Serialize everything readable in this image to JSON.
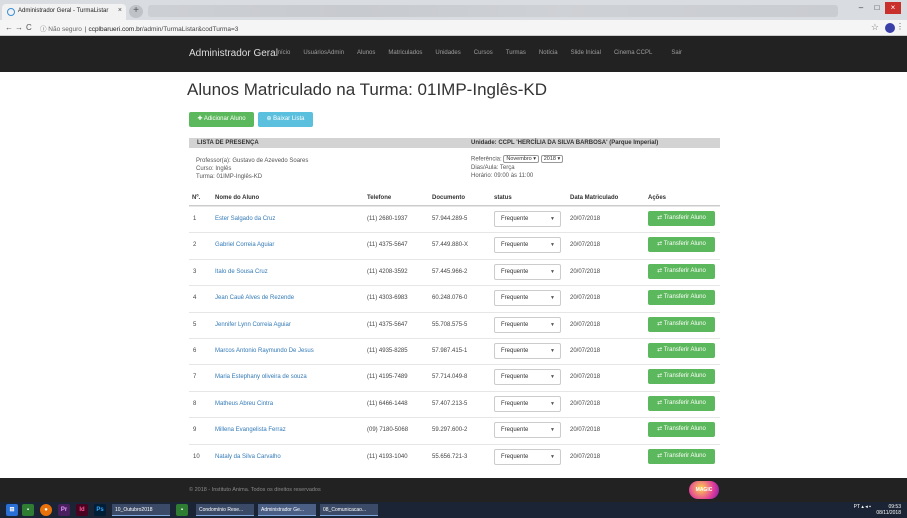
{
  "browser": {
    "tab_title": "Administrador Geral - TurmaListar",
    "tab_close": "×",
    "new_tab": "+",
    "url_security": "ⓘ Não seguro",
    "url_host": "ccplbarueri.com.br",
    "url_path": "/admin/TurmaListar&codTurma=3",
    "back": "←",
    "forward": "→",
    "reload": "C",
    "star": "☆",
    "menu": "⋮",
    "win_min": "–",
    "win_max": "□",
    "win_close": "×"
  },
  "nav": {
    "brand": "Administrador Geral",
    "links": [
      "Início",
      "UsuáriosAdmin",
      "Alunos",
      "Matriculados",
      "Unidades",
      "Cursos",
      "Turmas",
      "Notícia",
      "Slide Inicial",
      "Cinema CCPL",
      "Sair"
    ]
  },
  "page": {
    "title": "Alunos Matriculado na Turma: 01IMP-Inglês-KD",
    "add_button": "✚ Adicionar Aluno",
    "download_button": "⊕ Baixar Lista"
  },
  "presenca": {
    "left_label": "LISTA DE PRESENÇA",
    "right_label": "Unidade: CCPL 'HERCÍLIA DA SILVA BARBOSA' (Parque Imperial)",
    "professor": "Professor(a): Gustavo de Azevedo Soares",
    "curso": "Curso: Inglês",
    "turma": "Turma: 01IMP-Inglês-KD",
    "referencia_label": "Referência:",
    "mes": "Novembro ▾",
    "ano": "2018 ▾",
    "dias": "Dias/Aula: Terça",
    "horario": "Horário: 09:00 às 11:00"
  },
  "table": {
    "headers": {
      "n": "Nº.",
      "nome": "Nome do Aluno",
      "telefone": "Telefone",
      "documento": "Documento",
      "status": "status",
      "data": "Data Matriculado",
      "acoes": "Ações"
    },
    "rows": [
      {
        "n": "1",
        "nome": "Ester Salgado da Cruz",
        "telefone": "(11) 2680-1937",
        "documento": "57.944.289-5",
        "status": "Frequente",
        "data": "20/07/2018"
      },
      {
        "n": "2",
        "nome": "Gabriel Correia Aguiar",
        "telefone": "(11) 4375-5647",
        "documento": "57.449.880-X",
        "status": "Frequente",
        "data": "20/07/2018"
      },
      {
        "n": "3",
        "nome": "Italo de Sousa Cruz",
        "telefone": "(11) 4208-3592",
        "documento": "57.445.966-2",
        "status": "Frequente",
        "data": "20/07/2018"
      },
      {
        "n": "4",
        "nome": "Jean Cauê Alves de Rezende",
        "telefone": "(11) 4303-6983",
        "documento": "60.248.076-0",
        "status": "Frequente",
        "data": "20/07/2018"
      },
      {
        "n": "5",
        "nome": "Jennifer Lynn Correia Aguiar",
        "telefone": "(11) 4375-5647",
        "documento": "55.708.575-5",
        "status": "Frequente",
        "data": "20/07/2018"
      },
      {
        "n": "6",
        "nome": "Marcos Antonio Raymundo De Jesus",
        "telefone": "(11) 4935-8285",
        "documento": "57.987.415-1",
        "status": "Frequente",
        "data": "20/07/2018"
      },
      {
        "n": "7",
        "nome": "Maria Estephany oliveira de souza",
        "telefone": "(11) 4195-7489",
        "documento": "57.714.049-8",
        "status": "Frequente",
        "data": "20/07/2018"
      },
      {
        "n": "8",
        "nome": "Matheus Abreu Cintra",
        "telefone": "(11) 6466-1448",
        "documento": "57.407.213-5",
        "status": "Frequente",
        "data": "20/07/2018"
      },
      {
        "n": "9",
        "nome": "Millena Evangelista Ferraz",
        "telefone": "(09) 7180-5068",
        "documento": "59.297.600-2",
        "status": "Frequente",
        "data": "20/07/2018"
      },
      {
        "n": "10",
        "nome": "Nataly da Silva Carvalho",
        "telefone": "(11) 4193-1040",
        "documento": "55.656.721-3",
        "status": "Frequente",
        "data": "20/07/2018"
      }
    ],
    "transfer_button": "⇄ Transferir Aluno",
    "select_arrow": "▼"
  },
  "footer": {
    "text": "© 2018 - Instituto Anima. Todos os direitos reservados",
    "logo_text": "MAGIC"
  },
  "taskbar": {
    "items": [
      "10_Outubro2018",
      "Condomínio Rese...",
      "Administrador Ge...",
      "08_Comunicacao..."
    ],
    "clock_time": "09:53",
    "clock_date": "08/11/2018",
    "tray_lang": "PT"
  },
  "colors": {
    "success": "#5cb85c",
    "info": "#5bc0de",
    "link": "#337ab7",
    "navbar": "#222222"
  }
}
